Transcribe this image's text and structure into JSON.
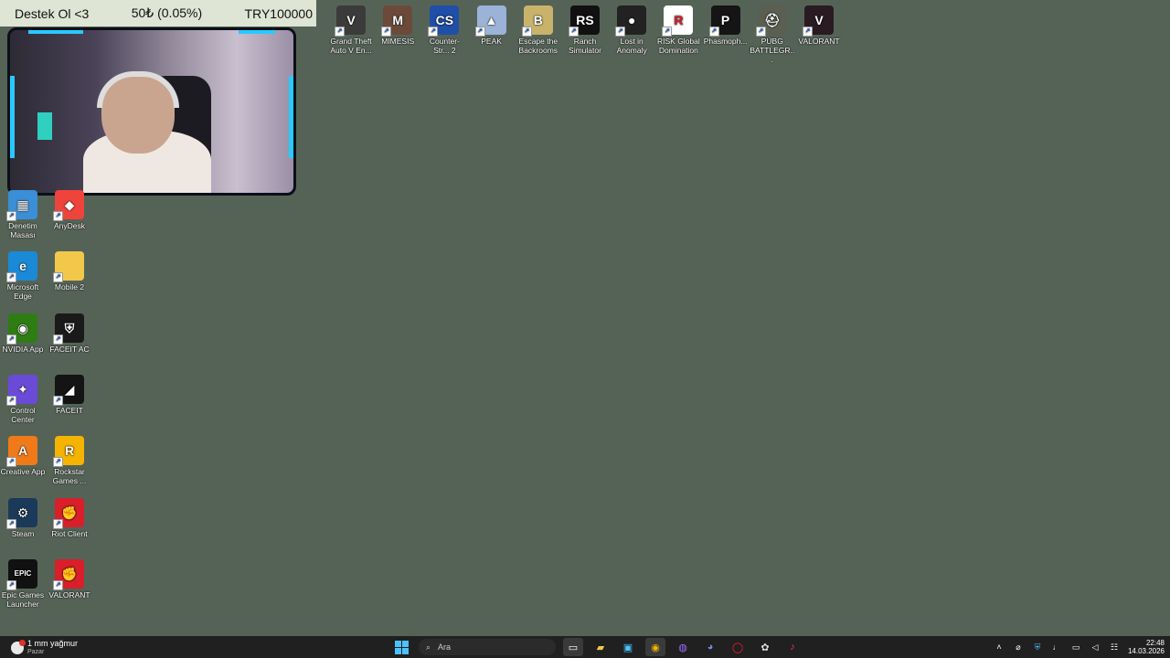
{
  "donation": {
    "left": "Destek Ol <3",
    "middle": "50₺ (0.05%)",
    "right": "TRY100000"
  },
  "desktop_icons_top": [
    {
      "label": "Grand Theft Auto V En...",
      "icon": "gta-v-icon",
      "color": "#3b3b3b",
      "glyph": "V"
    },
    {
      "label": "MIMESIS",
      "icon": "mimesis-icon",
      "color": "#6b4a3a",
      "glyph": "M"
    },
    {
      "label": "Counter-Str... 2",
      "icon": "counter-strike-icon",
      "color": "#1f4fa8",
      "glyph": "CS"
    },
    {
      "label": "PEAK",
      "icon": "peak-icon",
      "color": "#9bb3d6",
      "glyph": "▲"
    },
    {
      "label": "Escape the Backrooms",
      "icon": "escape-backrooms-icon",
      "color": "#c9b36b",
      "glyph": "B"
    },
    {
      "label": "Ranch Simulator",
      "icon": "ranch-simulator-icon",
      "color": "#111111",
      "glyph": "RS"
    },
    {
      "label": "Lost in Anomaly",
      "icon": "lost-in-anomaly-icon",
      "color": "#222222",
      "glyph": "●"
    },
    {
      "label": "RISK Global Domination",
      "icon": "risk-icon",
      "color": "#ffffff",
      "glyph": "R"
    },
    {
      "label": "Phasmoph...",
      "icon": "phasmophobia-icon",
      "color": "#151515",
      "glyph": "P"
    },
    {
      "label": "PUBG BATTLEGR...",
      "icon": "pubg-icon",
      "color": "#5a5f52",
      "glyph": "⛑"
    },
    {
      "label": "VALORANT",
      "icon": "valorant-icon",
      "color": "#2a1a22",
      "glyph": "V"
    }
  ],
  "desktop_icons_left": [
    {
      "label": "Denetim Masası",
      "icon": "control-panel-icon",
      "color": "#3a8fd6",
      "glyph": "▦"
    },
    {
      "label": "AnyDesk",
      "icon": "anydesk-icon",
      "color": "#ef443b",
      "glyph": "◆"
    },
    {
      "label": "Microsoft Edge",
      "icon": "edge-icon",
      "color": "#1b8ad6",
      "glyph": "e"
    },
    {
      "label": "Mobile 2",
      "icon": "folder-icon",
      "color": "#f2c84b",
      "glyph": ""
    },
    {
      "label": "NVIDIA App",
      "icon": "nvidia-icon",
      "color": "#2e7d12",
      "glyph": "◉"
    },
    {
      "label": "FACEIT AC",
      "icon": "faceit-ac-icon",
      "color": "#1a1a1a",
      "glyph": "⛨"
    },
    {
      "label": "Control Center",
      "icon": "control-center-icon",
      "color": "#6a4ad6",
      "glyph": "✦"
    },
    {
      "label": "FACEIT",
      "icon": "faceit-icon",
      "color": "#141414",
      "glyph": "◢"
    },
    {
      "label": "Creative App",
      "icon": "creative-app-icon",
      "color": "#f07a1a",
      "glyph": "A"
    },
    {
      "label": "Rockstar Games ...",
      "icon": "rockstar-icon",
      "color": "#f5b400",
      "glyph": "R"
    },
    {
      "label": "Steam",
      "icon": "steam-icon",
      "color": "#1b3a5a",
      "glyph": "⚙"
    },
    {
      "label": "Riot Client",
      "icon": "riot-client-icon",
      "color": "#d81f2a",
      "glyph": "✊"
    },
    {
      "label": "Epic Games Launcher",
      "icon": "epic-games-icon",
      "color": "#111111",
      "glyph": "EPIC"
    },
    {
      "label": "VALORANT",
      "icon": "valorant-icon",
      "color": "#d81f2a",
      "glyph": "✊"
    }
  ],
  "taskbar": {
    "weather_temp": "1 mm yağmur",
    "weather_day": "Pazar",
    "search_placeholder": "Ara",
    "time": "22:48",
    "date": "14.03.2026"
  }
}
